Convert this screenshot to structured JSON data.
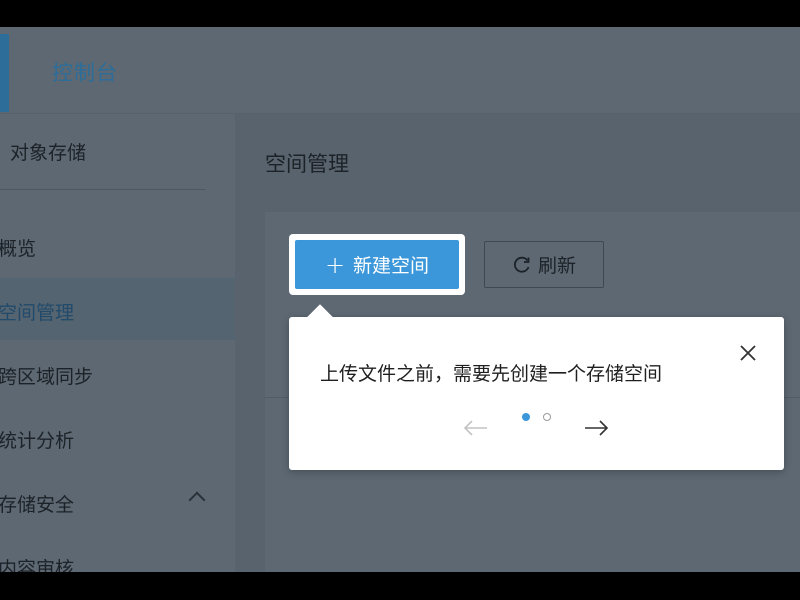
{
  "header": {
    "title": "控制台"
  },
  "sidebar": {
    "section_title": "对象存储",
    "items": [
      {
        "label": "概览"
      },
      {
        "label": "空间管理"
      },
      {
        "label": "跨区域同步"
      },
      {
        "label": "统计分析"
      },
      {
        "label": "存储安全"
      },
      {
        "label": "内容审核"
      }
    ]
  },
  "main": {
    "page_title": "空间管理",
    "new_button": {
      "icon": "+",
      "label": "新建空间"
    },
    "refresh_button": {
      "label": "刷新"
    }
  },
  "popover": {
    "text": "上传文件之前，需要先创建一个存储空间",
    "active_step": 1,
    "total_steps": 2
  },
  "colors": {
    "accent": "#3b97d9",
    "brand_dark": "#2c6d9a",
    "overlay": "#5b6670"
  }
}
